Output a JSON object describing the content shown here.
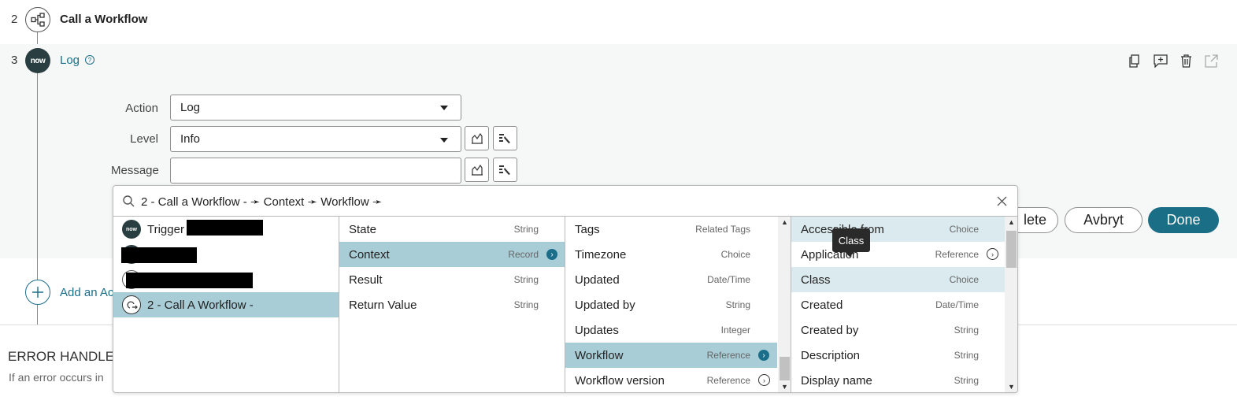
{
  "steps": [
    {
      "num": "2",
      "title": "Call a Workflow"
    },
    {
      "num": "3",
      "title": "Log",
      "logo": "now"
    }
  ],
  "form": {
    "action_label": "Action",
    "action_value": "Log",
    "level_label": "Level",
    "level_value": "Info",
    "message_label": "Message",
    "message_value": ""
  },
  "buttons": {
    "delete_partial": "lete",
    "cancel": "Avbryt",
    "done": "Done"
  },
  "add_action_partial": "Add an Ac",
  "error_handler": {
    "title": "ERROR HANDLER",
    "text_partial": "If an error occurs in"
  },
  "picker": {
    "search_value": "2 - Call a Workflow - ➛ Context ➛ Workflow ➛",
    "col1": [
      {
        "name": "Trigger",
        "logo": "now"
      },
      {
        "name": ""
      },
      {
        "name": ""
      },
      {
        "name": "2 - Call A Workflow -"
      }
    ],
    "col2": [
      {
        "name": "State",
        "type": "String"
      },
      {
        "name": "Context",
        "type": "Record"
      },
      {
        "name": "Result",
        "type": "String"
      },
      {
        "name": "Return Value",
        "type": "String"
      }
    ],
    "col3": [
      {
        "name": "Tags",
        "type": "Related Tags"
      },
      {
        "name": "Timezone",
        "type": "Choice"
      },
      {
        "name": "Updated",
        "type": "Date/Time"
      },
      {
        "name": "Updated by",
        "type": "String"
      },
      {
        "name": "Updates",
        "type": "Integer"
      },
      {
        "name": "Workflow",
        "type": "Reference"
      },
      {
        "name": "Workflow version",
        "type": "Reference"
      }
    ],
    "col4": [
      {
        "name": "Accessible from",
        "type": "Choice"
      },
      {
        "name": "Application",
        "type": "Reference"
      },
      {
        "name": "Class",
        "type": "Choice"
      },
      {
        "name": "Created",
        "type": "Date/Time"
      },
      {
        "name": "Created by",
        "type": "String"
      },
      {
        "name": "Description",
        "type": "String"
      },
      {
        "name": "Display name",
        "type": "String"
      }
    ]
  },
  "tooltip": "Class",
  "colors": {
    "accent": "#1b6e8a",
    "done_bg": "#1a6e86",
    "selected_row": "#a9cdd6",
    "hover_row": "#dbeaee",
    "panel_bg": "#f6f7f7"
  }
}
